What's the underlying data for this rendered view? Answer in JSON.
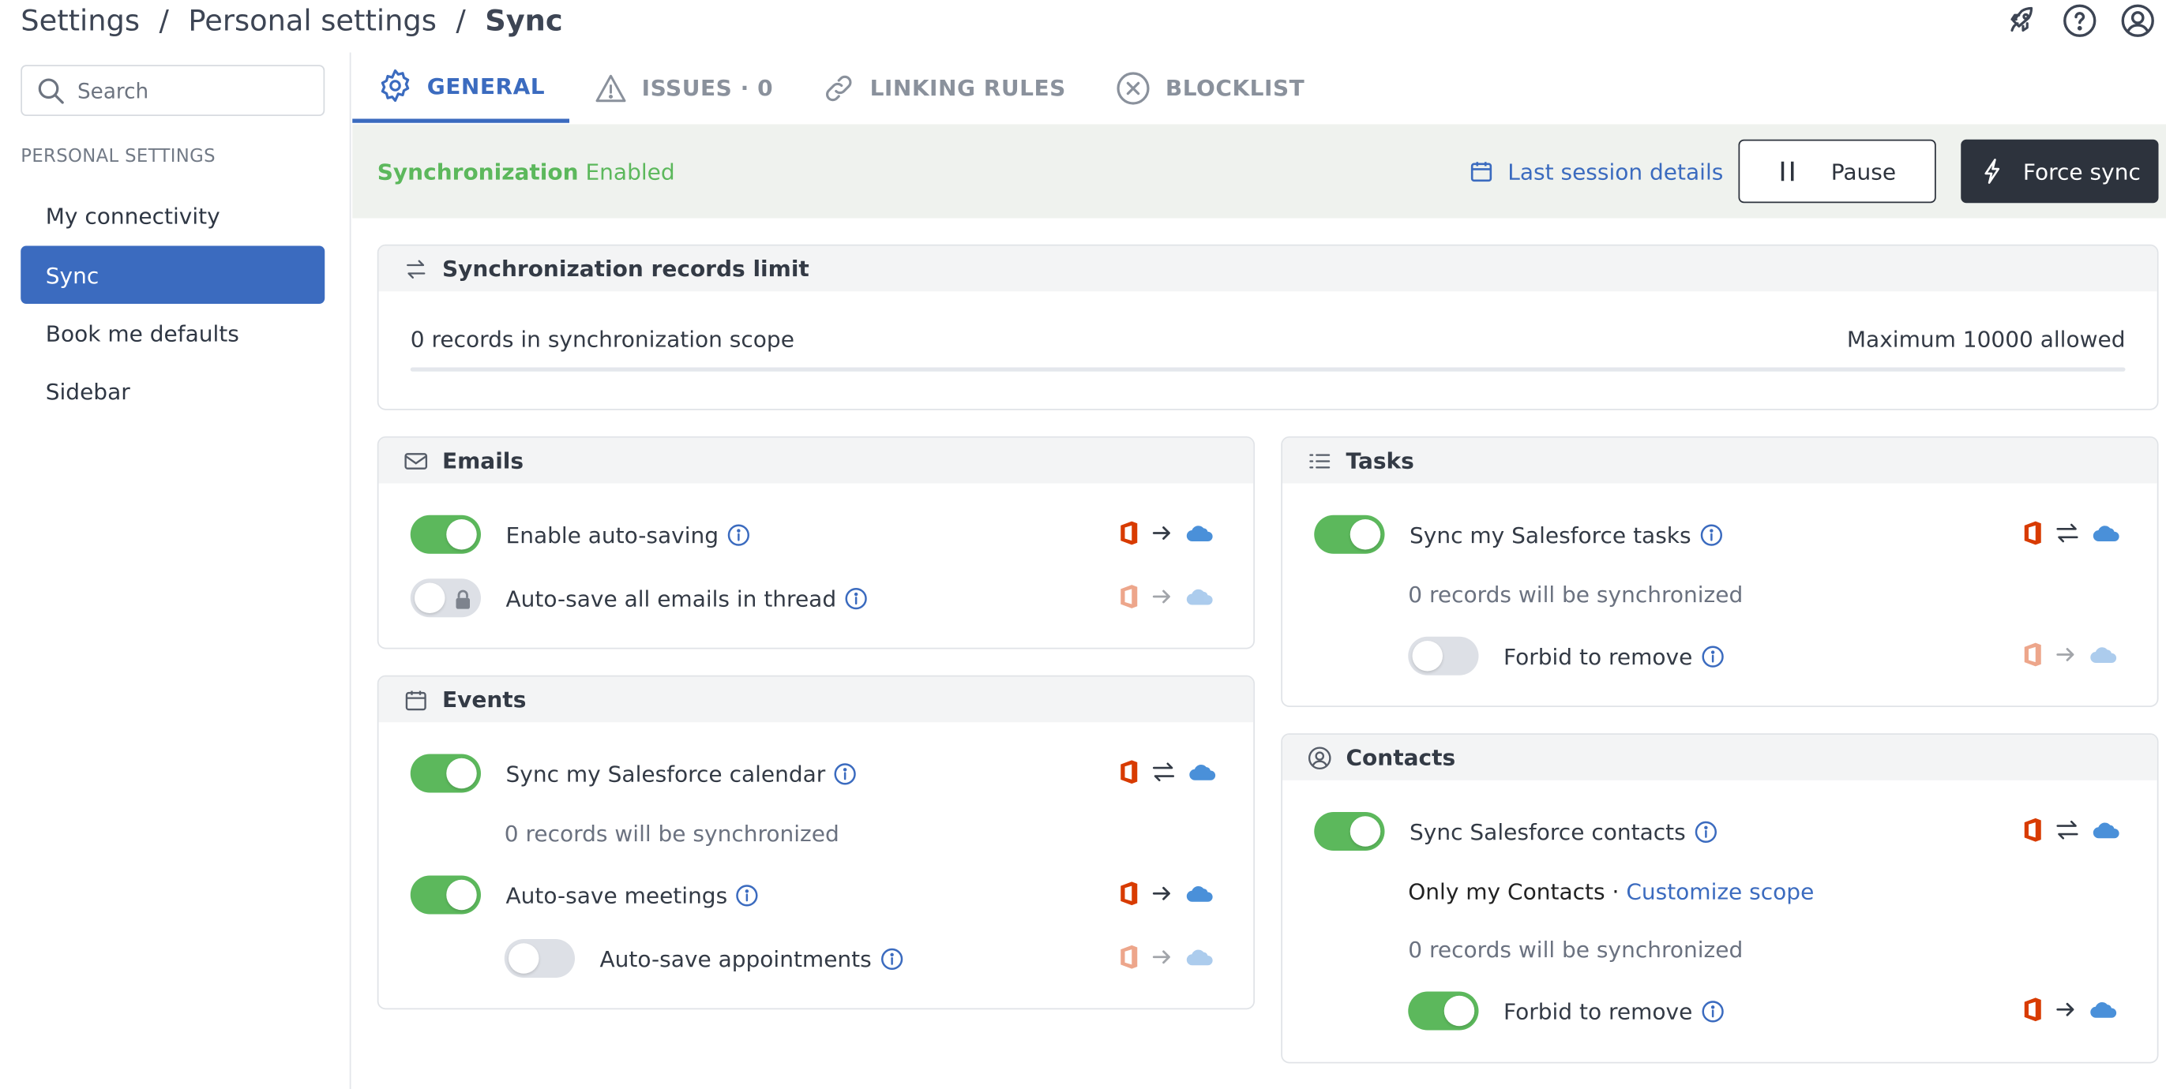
{
  "breadcrumb": [
    "Settings",
    "Personal settings",
    "Sync"
  ],
  "topbar": {
    "icons": [
      "rocket-icon",
      "help-icon",
      "user-icon"
    ]
  },
  "search": {
    "placeholder": "Search",
    "value": ""
  },
  "sidebar": {
    "section_title": "PERSONAL SETTINGS",
    "items": [
      {
        "label": "My connectivity",
        "active": false
      },
      {
        "label": "Sync",
        "active": true
      },
      {
        "label": "Book me defaults",
        "active": false
      },
      {
        "label": "Sidebar",
        "active": false
      }
    ]
  },
  "tabs": [
    {
      "label": "GENERAL",
      "icon": "gear-icon",
      "active": true
    },
    {
      "label": "ISSUES · 0",
      "icon": "warning-icon",
      "active": false
    },
    {
      "label": "LINKING RULES",
      "icon": "link-icon",
      "active": false
    },
    {
      "label": "BLOCKLIST",
      "icon": "block-icon",
      "active": false
    }
  ],
  "status": {
    "label": "Synchronization",
    "state": "Enabled",
    "last_session": "Last session details",
    "pause": "Pause",
    "force_sync": "Force sync"
  },
  "records_limit": {
    "title": "Synchronization records limit",
    "scope_text": "0 records in synchronization scope",
    "max_text": "Maximum 10000 allowed",
    "fill_fraction": 0
  },
  "emails": {
    "title": "Emails",
    "rows": [
      {
        "label": "Enable auto-saving",
        "on": true,
        "direction": "→",
        "locked": false
      },
      {
        "label": "Auto-save all emails in thread",
        "on": false,
        "direction": "→",
        "locked": true
      }
    ]
  },
  "events": {
    "title": "Events",
    "rows": [
      {
        "label": "Sync my Salesforce calendar",
        "on": true,
        "direction": "⇄"
      },
      {
        "label": "Auto-save meetings",
        "on": true,
        "direction": "→"
      },
      {
        "label": "Auto-save appointments",
        "on": false,
        "direction": "→"
      }
    ],
    "sync_note": "0 records will be synchronized"
  },
  "tasks": {
    "title": "Tasks",
    "rows": [
      {
        "label": "Sync my Salesforce tasks",
        "on": true,
        "direction": "⇄"
      },
      {
        "label": "Forbid to remove",
        "on": false,
        "direction": "→"
      }
    ],
    "sync_note": "0 records will be synchronized"
  },
  "contacts": {
    "title": "Contacts",
    "rows": [
      {
        "label": "Sync Salesforce contacts",
        "on": true,
        "direction": "⇄"
      },
      {
        "label": "Forbid to remove",
        "on": true,
        "direction": "→"
      }
    ],
    "scope_label": "Only my Contacts",
    "scope_sep": "·",
    "customize": "Customize scope",
    "sync_note": "0 records will be synchronized"
  },
  "colors": {
    "accent": "#3b6bbf",
    "success": "#5cb85c",
    "dark": "#2d333d",
    "office": "#d83b01",
    "salesforce": "#4a90d9"
  }
}
